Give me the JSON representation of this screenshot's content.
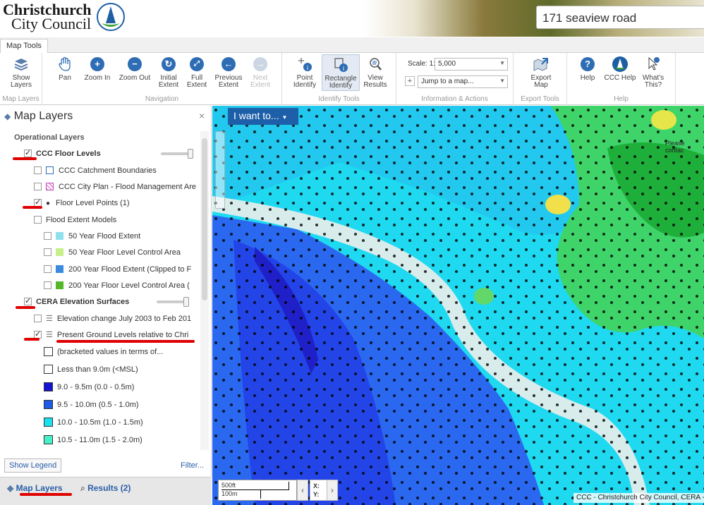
{
  "header": {
    "brand_line1": "Christchurch",
    "brand_line2": "City Council",
    "search_value": "171 seaview road"
  },
  "tabs": [
    "Map Tools"
  ],
  "ribbon": {
    "groups": [
      {
        "title": "Map Layers",
        "buttons": [
          {
            "label1": "Show",
            "label2": "Layers",
            "icon": "layers-icon"
          }
        ]
      },
      {
        "title": "Navigation",
        "buttons": [
          {
            "label1": "Pan",
            "label2": "",
            "icon": "pan-hand-icon"
          },
          {
            "label1": "Zoom In",
            "label2": "",
            "icon": "zoom-in-icon"
          },
          {
            "label1": "Zoom Out",
            "label2": "",
            "icon": "zoom-out-icon"
          },
          {
            "label1": "Initial",
            "label2": "Extent",
            "icon": "initial-extent-icon"
          },
          {
            "label1": "Full",
            "label2": "Extent",
            "icon": "full-extent-icon"
          },
          {
            "label1": "Previous",
            "label2": "Extent",
            "icon": "previous-extent-icon"
          },
          {
            "label1": "Next",
            "label2": "Extent",
            "icon": "next-extent-icon"
          }
        ]
      },
      {
        "title": "Identify Tools",
        "buttons": [
          {
            "label1": "Point",
            "label2": "Identify",
            "icon": "point-identify-icon"
          },
          {
            "label1": "Rectangle",
            "label2": "Identify",
            "icon": "rectangle-identify-icon"
          },
          {
            "label1": "View",
            "label2": "Results",
            "icon": "view-results-icon"
          }
        ]
      },
      {
        "title": "Information & Actions",
        "scale_label": "Scale: 1:",
        "scale_value": "5,000",
        "jump_placeholder": "Jump to a map..."
      },
      {
        "title": "Export Tools",
        "buttons": [
          {
            "label1": "Export",
            "label2": "Map",
            "icon": "export-map-icon"
          }
        ]
      },
      {
        "title": "Help",
        "buttons": [
          {
            "label1": "Help",
            "label2": "",
            "icon": "help-icon"
          },
          {
            "label1": "CCC Help",
            "label2": "",
            "icon": "ccc-help-icon"
          },
          {
            "label1": "What's",
            "label2": "This?",
            "icon": "whats-this-icon"
          }
        ]
      }
    ]
  },
  "panel": {
    "title": "Map Layers",
    "close": "×",
    "section": "Operational Layers",
    "layers": [
      {
        "label": "CCC Floor Levels",
        "checked": true,
        "bold": true
      },
      {
        "label": "CCC Catchment Boundaries",
        "checked": false
      },
      {
        "label": "CCC City Plan - Flood Management Are",
        "checked": false
      },
      {
        "label": "Floor Level Points (1)",
        "checked": true
      },
      {
        "label": "Flood Extent Models",
        "checked": false
      },
      {
        "label": "50 Year Flood Extent",
        "checked": false,
        "color": "#8fe0ef"
      },
      {
        "label": "50 Year Floor Level Control Area",
        "checked": false,
        "color": "#c7f08a"
      },
      {
        "label": "200 Year Flood Extent (Clipped to F",
        "checked": false,
        "color": "#3a8be0"
      },
      {
        "label": "200 Year Floor Level Control Area (",
        "checked": false,
        "color": "#55b829"
      },
      {
        "label": "CERA Elevation Surfaces",
        "checked": true,
        "bold": true
      },
      {
        "label": "Elevation change July 2003 to Feb 201",
        "checked": false
      },
      {
        "label": "Present Ground Levels relative to Chri",
        "checked": true
      }
    ],
    "legend": [
      {
        "label": "(bracketed values in terms of...",
        "color": "#ffffff"
      },
      {
        "label": "Less than 9.0m (<MSL)",
        "color": "#ffffff"
      },
      {
        "label": "9.0 - 9.5m (0.0 - 0.5m)",
        "color": "#1414d2"
      },
      {
        "label": "9.5 - 10.0m (0.5 - 1.0m)",
        "color": "#1e5ae6"
      },
      {
        "label": "10.0 - 10.5m (1.0 - 1.5m)",
        "color": "#19e1f0"
      },
      {
        "label": "10.5 - 11.0m (1.5 - 2.0m)",
        "color": "#46f0c8"
      }
    ],
    "show_legend": "Show Legend",
    "filter": "Filter...",
    "bottom_tabs": [
      "Map Layers",
      "Results (2)"
    ]
  },
  "map": {
    "i_want": "I want to...",
    "scale_ft": "500ft",
    "scale_m": "100m",
    "x_label": "X:",
    "y_label": "Y:",
    "attribution": "CCC - Christchurch City Council, CERA -",
    "notice": "Please contac"
  }
}
